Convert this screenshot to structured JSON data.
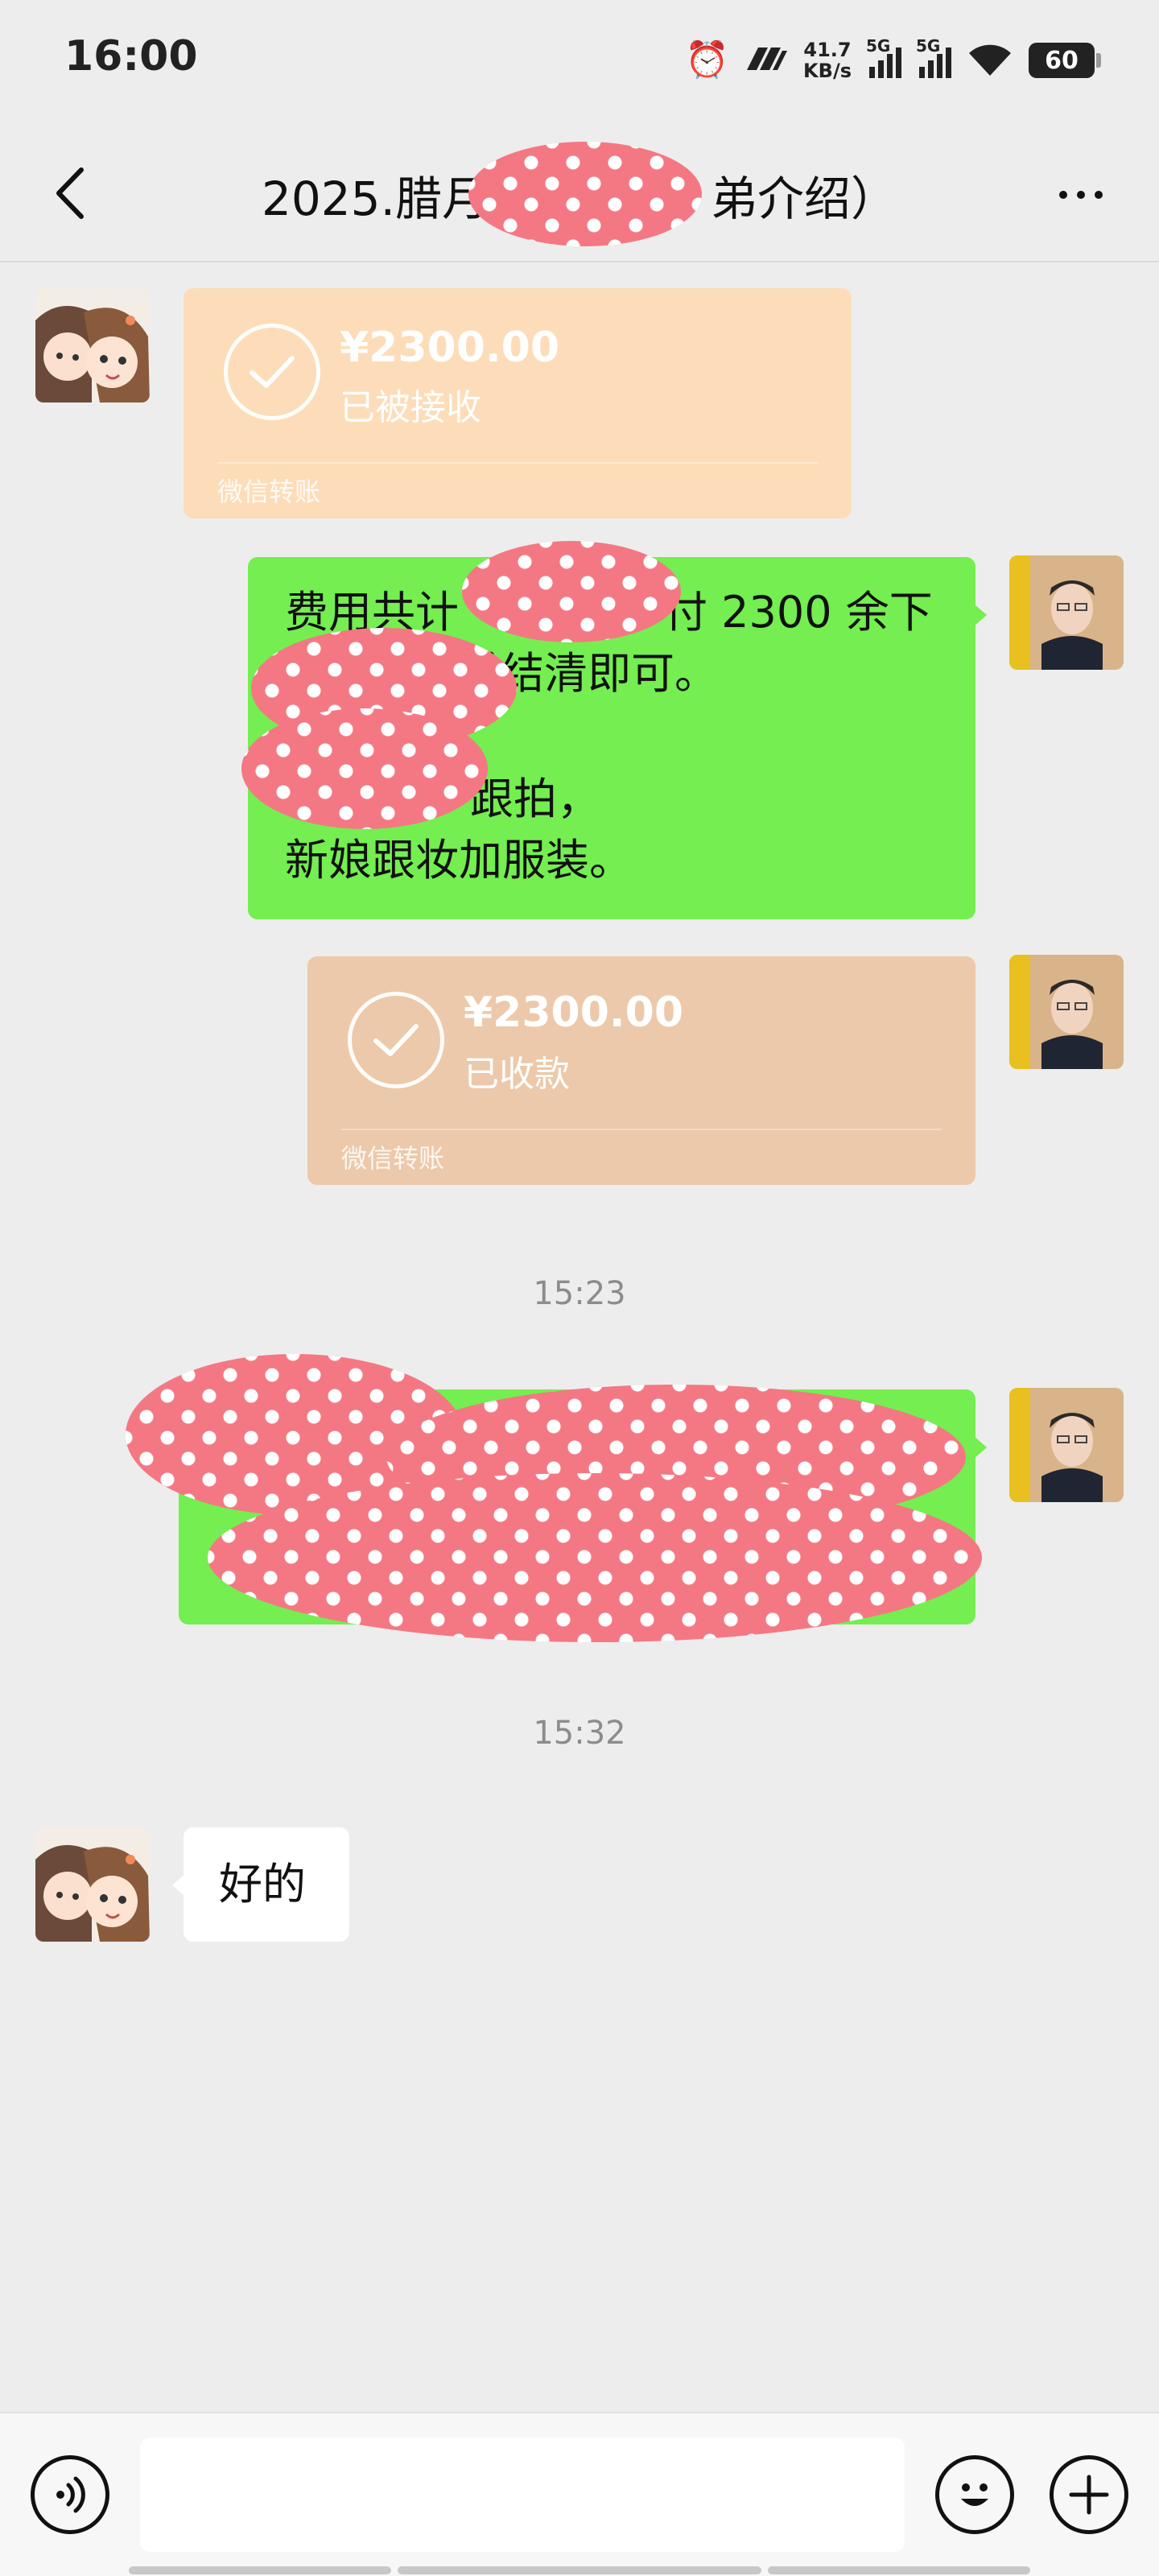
{
  "status_bar": {
    "time": "16:00",
    "net_speed_value": "41.7",
    "net_speed_unit": "KB/s",
    "signal_1_label": "5G",
    "signal_2_label": "5G",
    "battery": "60",
    "icons": [
      "alarm-icon",
      "nfc-icon",
      "signal-icon",
      "signal-icon",
      "wifi-icon",
      "battery-icon"
    ]
  },
  "header": {
    "title_start": "2025.腊月",
    "title_end": "弟介绍）",
    "back_icon": "chevron-left-icon",
    "more_icon": "more-dots-icon"
  },
  "messages": {
    "transfer_received": {
      "amount": "¥2300.00",
      "status": "已被接收",
      "label": "微信转账",
      "color": "#fdddb9"
    },
    "fee_text": {
      "line1_start": "费用共计",
      "line1_end": "付 2300 余下",
      "line2": "手结清即可。",
      "line3": "跟拍，",
      "line4": "新娘跟妆加服装。"
    },
    "transfer_sent": {
      "amount": "¥2300.00",
      "status": "已收款",
      "label": "微信转账",
      "color": "#ecc9aa"
    },
    "time_1": "15:23",
    "time_2": "15:32",
    "reply": "好的"
  },
  "input_bar": {
    "voice_icon": "voice-icon",
    "emoji_icon": "emoji-icon",
    "plus_icon": "plus-icon",
    "placeholder": ""
  },
  "colors": {
    "bubble_green": "#74ee50",
    "redaction": "#f47883",
    "background": "#ededed"
  }
}
